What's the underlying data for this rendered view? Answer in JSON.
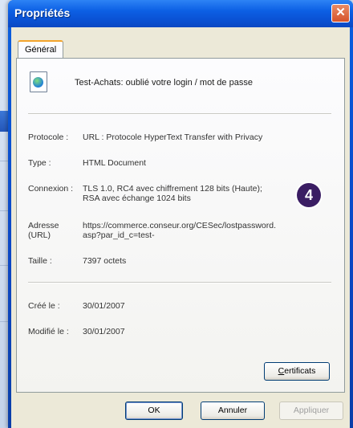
{
  "window": {
    "title": "Propriétés",
    "close_glyph": "✕"
  },
  "tabs": [
    {
      "label": "Général",
      "active": true
    }
  ],
  "document": {
    "icon": "html-document-icon",
    "title": "Test-Achats: oublié votre login / mot de passe"
  },
  "properties": {
    "protocol": {
      "label": "Protocole :",
      "value": "URL : Protocole HyperText Transfer with Privacy"
    },
    "type": {
      "label": "Type :",
      "value": "HTML Document"
    },
    "connection": {
      "label": "Connexion :",
      "value_line1": "TLS 1.0, RC4 avec chiffrement 128 bits (Haute);",
      "value_line2": "RSA avec échange 1024 bits"
    },
    "address": {
      "label_line1": "Adresse",
      "label_line2": "(URL)",
      "value_line1": "https://commerce.conseur.org/CESec/lostpassword.",
      "value_line2": "asp?par_id_c=test-"
    },
    "size": {
      "label": "Taille :",
      "value": "7397 octets"
    },
    "created": {
      "label": "Créé le :",
      "value": "30/01/2007"
    },
    "modified": {
      "label": "Modifié le :",
      "value": "30/01/2007"
    }
  },
  "badge": {
    "text": "4",
    "color": "#3a1d63"
  },
  "buttons": {
    "certificates": "Certificats",
    "ok": "OK",
    "cancel": "Annuler",
    "apply": "Appliquer"
  },
  "colors": {
    "titlebar": "#0c5fe4",
    "dialog_bg": "#ece9d8",
    "tab_accent": "#f3a42c",
    "close": "#d6532a"
  }
}
